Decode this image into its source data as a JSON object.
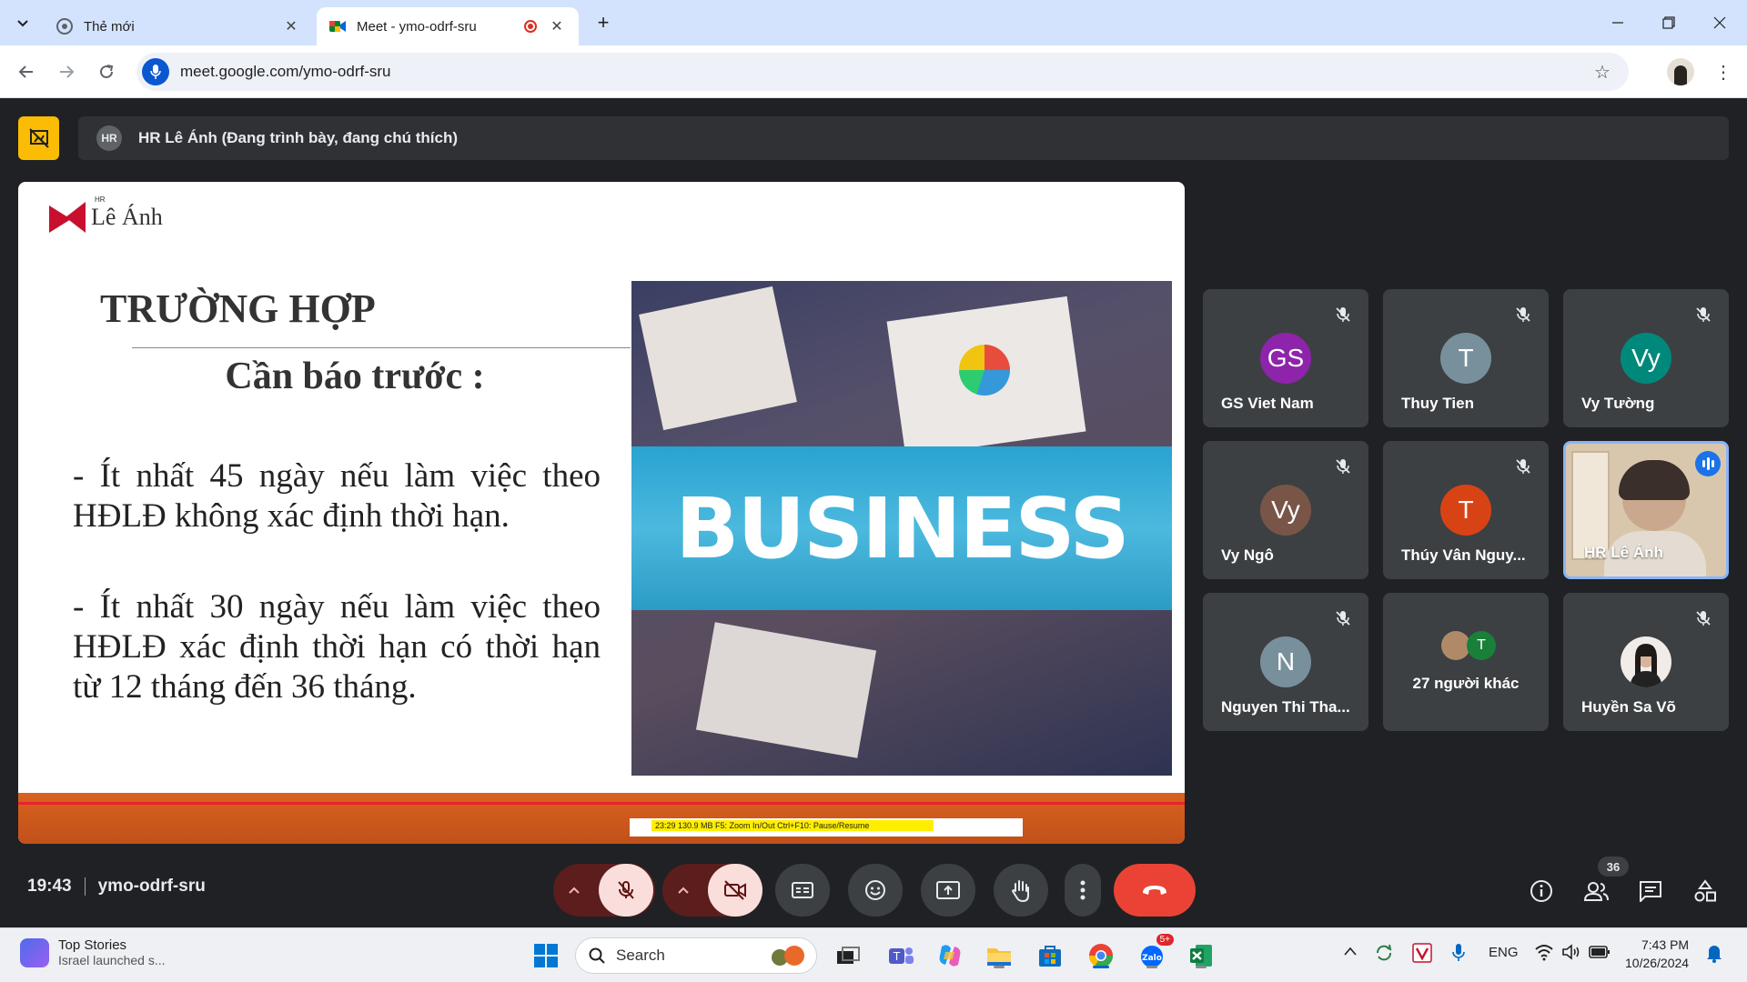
{
  "browser": {
    "tabs": [
      {
        "title": "Thẻ mới",
        "active": false
      },
      {
        "title": "Meet - ymo-odrf-sru",
        "active": true,
        "recording": true
      }
    ],
    "url": "meet.google.com/ymo-odrf-sru"
  },
  "meet": {
    "presenting_text": "HR Lê Ánh (Đang trình bày, đang chú thích)",
    "presenter_initials": "HR",
    "slide": {
      "logo_superscript": "HR",
      "logo_text": "Lê Ánh",
      "title": "TRƯỜNG HỢP",
      "subtitle": "Cần báo trước :",
      "bullet1": "- Ít nhất 45 ngày nếu làm việc theo HĐLĐ không xác định thời hạn.",
      "bullet2": "- Ít nhất 30 ngày nếu làm việc theo HĐLĐ xác định thời hạn có thời hạn từ 12 tháng đến 36 tháng.",
      "photo_word": "BUSINESS",
      "recorder_text": "23:29   130.9 MB   F5: Zoom In/Out   Ctrl+F10: Pause/Resume"
    },
    "participants": [
      {
        "initials": "GS",
        "name": "GS Viet Nam",
        "color": "#8e24aa",
        "muted": true
      },
      {
        "initials": "T",
        "name": "Thuy Tien",
        "color": "#78909c",
        "muted": true
      },
      {
        "initials": "Vy",
        "name": "Vy Tường",
        "color": "#00897b",
        "muted": true
      },
      {
        "initials": "Vy",
        "name": "Vy Ngô",
        "color": "#795548",
        "muted": true
      },
      {
        "initials": "T",
        "name": "Thúy Vân Nguy...",
        "color": "#d84315",
        "muted": true
      },
      {
        "initials": "",
        "name": "HR Lê Ánh",
        "color": "",
        "muted": false,
        "video": true
      },
      {
        "initials": "N",
        "name": "Nguyen Thi Tha...",
        "color": "#78909c",
        "muted": true
      },
      {
        "initials": "T",
        "name": "27 người khác",
        "color": "#188038",
        "muted": false
      },
      {
        "initials": "",
        "name": "Huyền Sa Võ",
        "color": "#eee",
        "muted": true
      }
    ],
    "time": "19:43",
    "meeting_code": "ymo-odrf-sru",
    "participant_count": "36"
  },
  "taskbar": {
    "news_title": "Top Stories",
    "news_sub": "Israel launched s...",
    "search_label": "Search",
    "lang": "ENG",
    "time": "7:43 PM",
    "date": "10/26/2024",
    "zalo_badge": "5+"
  },
  "colors": {
    "meet_bg": "#202124",
    "tile_bg": "#3c4043",
    "hangup": "#ea4335",
    "present_yellow": "#fbbc04",
    "tabstrip": "#d3e3fd"
  }
}
